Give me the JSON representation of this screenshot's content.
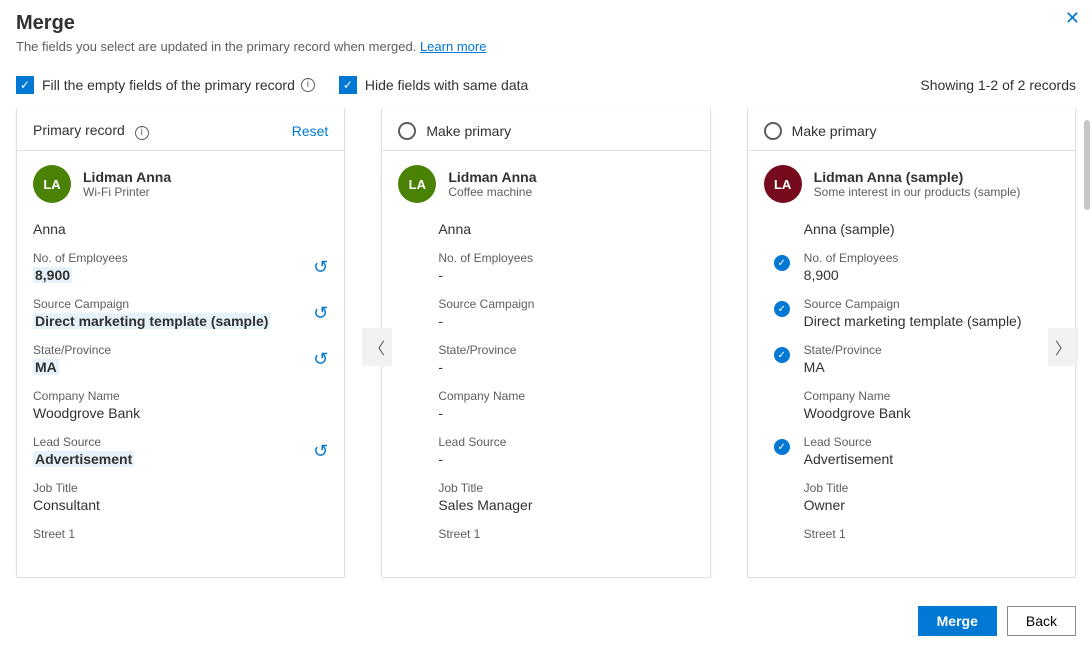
{
  "header": {
    "title": "Merge",
    "subtitle_text": "The fields you select are updated in the primary record when merged.",
    "learn_more": "Learn more"
  },
  "options": {
    "fill_empty": "Fill the empty fields of the primary record",
    "hide_same": "Hide fields with same data",
    "record_count": "Showing 1-2 of 2 records"
  },
  "labels": {
    "primary_record": "Primary record",
    "reset": "Reset",
    "make_primary": "Make primary"
  },
  "fields": {
    "no_employees": "No. of Employees",
    "source_campaign": "Source Campaign",
    "state": "State/Province",
    "company": "Company Name",
    "lead_source": "Lead Source",
    "job_title": "Job Title",
    "street1": "Street 1"
  },
  "records": [
    {
      "initials": "LA",
      "avatar_color": "green",
      "name": "Lidman Anna",
      "subtitle": "Wi-Fi Printer",
      "topic": "Anna",
      "no_employees": "8,900",
      "source_campaign": "Direct marketing template (sample)",
      "state": "MA",
      "company": "Woodgrove Bank",
      "lead_source": "Advertisement",
      "job_title": "Consultant",
      "street1": ""
    },
    {
      "initials": "LA",
      "avatar_color": "green",
      "name": "Lidman Anna",
      "subtitle": "Coffee machine",
      "topic": "Anna",
      "no_employees": "-",
      "source_campaign": "-",
      "state": "-",
      "company": "-",
      "lead_source": "-",
      "job_title": "Sales Manager",
      "street1": ""
    },
    {
      "initials": "LA",
      "avatar_color": "red",
      "name": "Lidman Anna (sample)",
      "subtitle": "Some interest in our products (sample)",
      "topic": "Anna (sample)",
      "no_employees": "8,900",
      "source_campaign": "Direct marketing template (sample)",
      "state": "MA",
      "company": "Woodgrove Bank",
      "lead_source": "Advertisement",
      "job_title": "Owner",
      "street1": ""
    }
  ],
  "footer": {
    "merge": "Merge",
    "back": "Back"
  }
}
